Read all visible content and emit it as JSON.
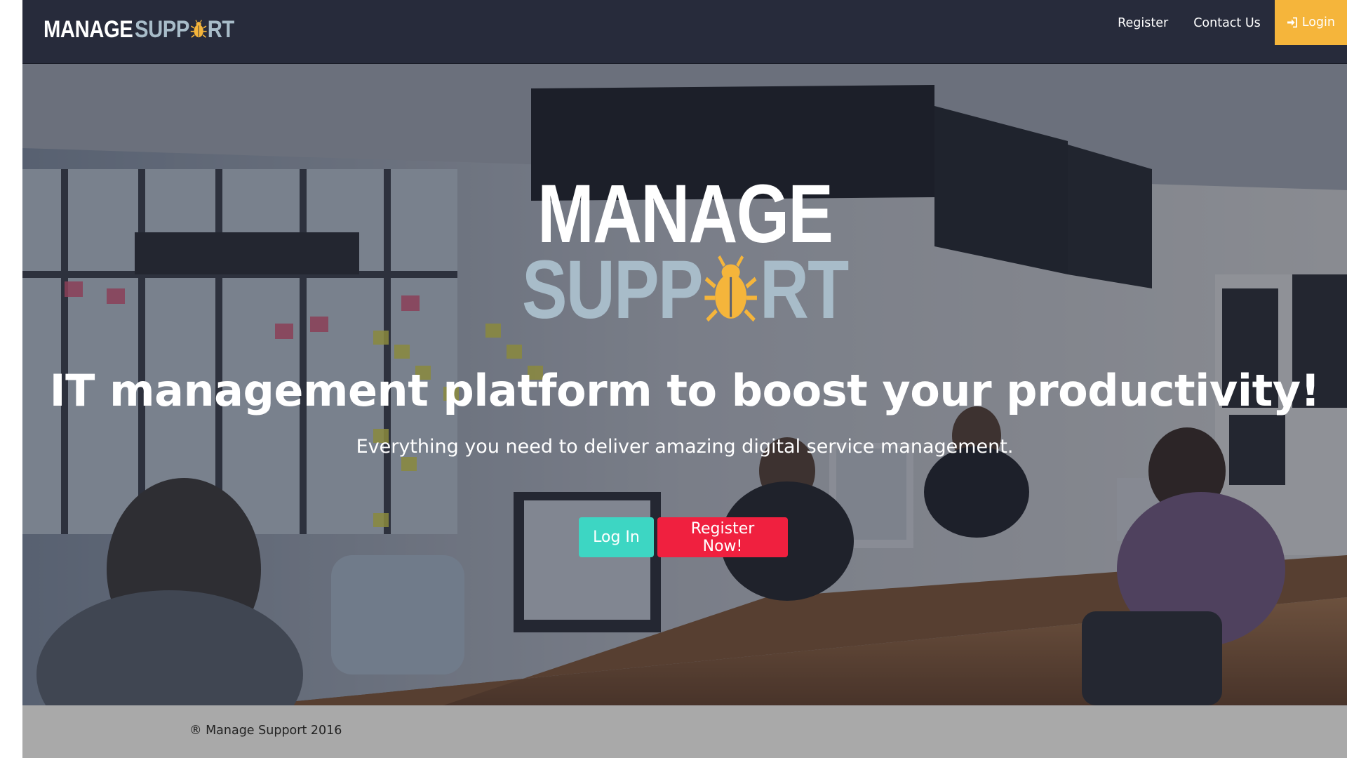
{
  "navbar": {
    "brand": {
      "word1": "MANAGE",
      "word2_prefix": "SUPP",
      "word2_suffix": "RT"
    },
    "links": {
      "register": "Register",
      "contact": "Contact Us",
      "login": "Login"
    },
    "icons": {
      "login": "sign-in-icon",
      "logo_mark": "bug-icon"
    }
  },
  "hero": {
    "logo": {
      "line1": "MANAGE",
      "line2_prefix": "SUPP",
      "line2_suffix": "RT"
    },
    "title": "IT management platform to boost your productivity!",
    "subtitle": "Everything you need to deliver amazing digital service management.",
    "buttons": {
      "login": "Log In",
      "register": "Register Now!"
    }
  },
  "footer": {
    "copyright": "® Manage Support 2016"
  },
  "colors": {
    "navbar_bg": "#272b3b",
    "accent_yellow": "#f5b53b",
    "logo_support": "#a8bcc9",
    "button_teal": "#3dd6c3",
    "button_red": "#f0203f",
    "footer_bg": "#a9a9a9"
  }
}
